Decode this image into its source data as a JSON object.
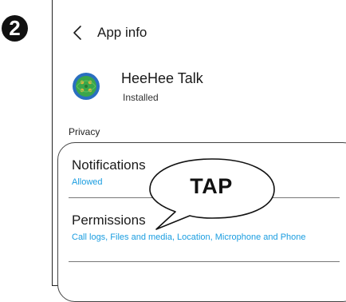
{
  "step": {
    "number": "2"
  },
  "header": {
    "back_icon": "chevron-left-icon",
    "title": "App info"
  },
  "app": {
    "icon": "heehee-talk-app-icon",
    "name": "HeeHee Talk",
    "status": "Installed"
  },
  "privacy": {
    "section_label": "Privacy",
    "items": [
      {
        "title": "Notifications",
        "subtitle": "Allowed"
      },
      {
        "title": "Permissions",
        "subtitle": "Call logs, Files and media, Location, Microphone and Phone"
      }
    ]
  },
  "callout": {
    "label": "TAP"
  },
  "colors": {
    "accent_blue": "#1a9de0",
    "badge": "#111111",
    "app_icon_green": "#3aa64a",
    "app_icon_blue": "#2a6fc0"
  }
}
